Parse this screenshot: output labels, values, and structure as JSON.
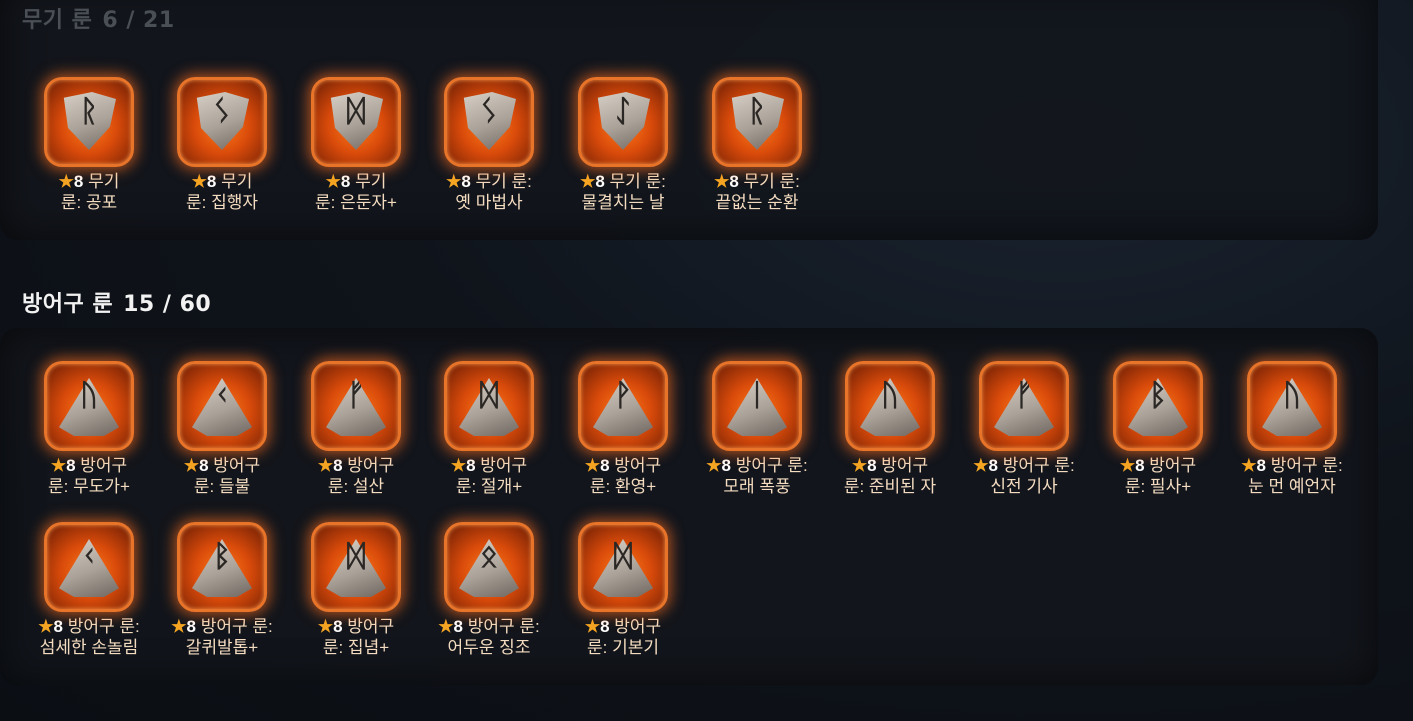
{
  "weapon_section": {
    "title": "무기 룬",
    "count": "6 / 21"
  },
  "armor_section": {
    "title": "방어구 룬",
    "count": "15 / 60"
  },
  "grade": {
    "star": "★",
    "value": "8"
  },
  "weapon_runes": [
    {
      "line1": "무기",
      "line2": "룬: 공포",
      "glyph": "ᚱ"
    },
    {
      "line1": "무기",
      "line2": "룬: 집행자",
      "glyph": "ᛊ"
    },
    {
      "line1": "무기",
      "line2": "룬: 은둔자+",
      "glyph": "ᛞ"
    },
    {
      "line1": "무기 룬:",
      "line2": "옛 마법사",
      "glyph": "ᛊ"
    },
    {
      "line1": "무기 룬:",
      "line2": "물결치는 날",
      "glyph": "ᛇ"
    },
    {
      "line1": "무기 룬:",
      "line2": "끝없는 순환",
      "glyph": "ᚱ"
    }
  ],
  "armor_runes": [
    {
      "line1": "방어구",
      "line2": "룬: 무도가+",
      "glyph": "ᚢ"
    },
    {
      "line1": "방어구",
      "line2": "룬: 들불",
      "glyph": "ᚲ"
    },
    {
      "line1": "방어구",
      "line2": "룬: 설산",
      "glyph": "ᚠ"
    },
    {
      "line1": "방어구",
      "line2": "룬: 절개+",
      "glyph": "ᛞ"
    },
    {
      "line1": "방어구",
      "line2": "룬: 환영+",
      "glyph": "ᚹ"
    },
    {
      "line1": "방어구 룬:",
      "line2": "모래 폭풍",
      "glyph": "ᛁ"
    },
    {
      "line1": "방어구",
      "line2": "룬: 준비된 자",
      "glyph": "ᚢ"
    },
    {
      "line1": "방어구 룬:",
      "line2": "신전 기사",
      "glyph": "ᚠ"
    },
    {
      "line1": "방어구",
      "line2": "룬: 필사+",
      "glyph": "ᛒ"
    },
    {
      "line1": "방어구 룬:",
      "line2": "눈 먼 예언자",
      "glyph": "ᚢ"
    },
    {
      "line1": "방어구 룬:",
      "line2": "섬세한 손놀림",
      "glyph": "ᚲ"
    },
    {
      "line1": "방어구 룬:",
      "line2": "갈퀴발톱+",
      "glyph": "ᛒ"
    },
    {
      "line1": "방어구",
      "line2": "룬: 집념+",
      "glyph": "ᛞ"
    },
    {
      "line1": "방어구 룬:",
      "line2": "어두운 징조",
      "glyph": "ᛟ"
    },
    {
      "line1": "방어구",
      "line2": "룬: 기본기",
      "glyph": "ᛞ"
    }
  ],
  "colors": {
    "frame": "#e8742a",
    "glow": "#ff7a1a",
    "star": "#f5a623",
    "label": "#f4dcc0"
  }
}
